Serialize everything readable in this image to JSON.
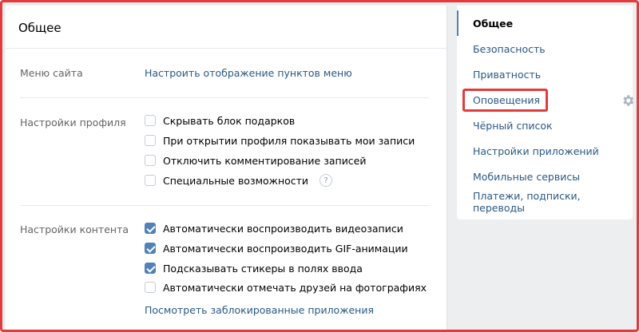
{
  "main": {
    "title": "Общее",
    "site_menu": {
      "label": "Меню сайта",
      "link": "Настроить отображение пунктов меню"
    },
    "profile_settings": {
      "label": "Настройки профиля",
      "options": [
        {
          "label": "Скрывать блок подарков",
          "checked": false
        },
        {
          "label": "При открытии профиля показывать мои записи",
          "checked": false
        },
        {
          "label": "Отключить комментирование записей",
          "checked": false
        },
        {
          "label": "Специальные возможности",
          "checked": false
        }
      ],
      "help_symbol": "?"
    },
    "content_settings": {
      "label": "Настройки контента",
      "options": [
        {
          "label": "Автоматически воспроизводить видеозаписи",
          "checked": true
        },
        {
          "label": "Автоматически воспроизводить GIF-анимации",
          "checked": true
        },
        {
          "label": "Подсказывать стикеры в полях ввода",
          "checked": true
        },
        {
          "label": "Автоматически отмечать друзей на фотографиях",
          "checked": false
        }
      ],
      "link": "Посмотреть заблокированные приложения"
    }
  },
  "sidebar": {
    "items": [
      {
        "label": "Общее",
        "active": true
      },
      {
        "label": "Безопасность",
        "active": false
      },
      {
        "label": "Приватность",
        "active": false
      },
      {
        "label": "Оповещения",
        "active": false
      },
      {
        "label": "Чёрный список",
        "active": false
      },
      {
        "label": "Настройки приложений",
        "active": false
      },
      {
        "label": "Мобильные сервисы",
        "active": false
      },
      {
        "label": "Платежи, подписки, переводы",
        "active": false
      }
    ],
    "gear_icon": "gear-icon"
  },
  "colors": {
    "accent": "#5181b8",
    "link": "#2a5885",
    "highlight": "#e23b3b"
  }
}
